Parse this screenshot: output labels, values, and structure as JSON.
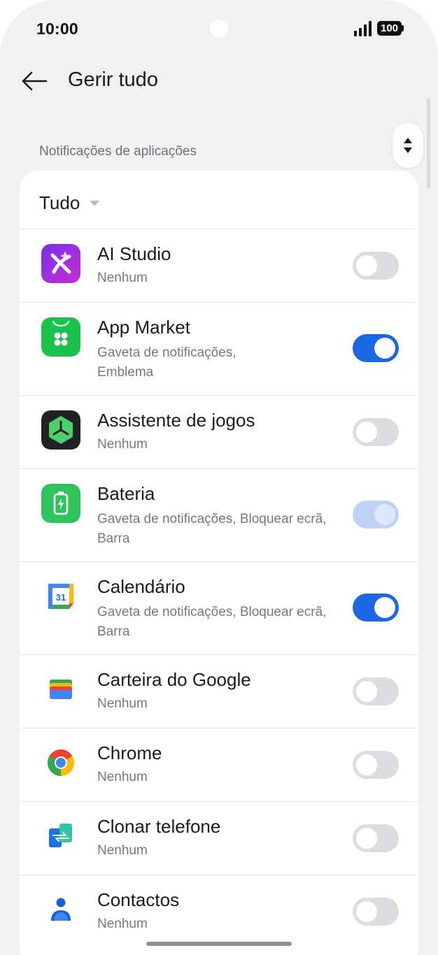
{
  "status_bar": {
    "time": "10:00",
    "battery": "100"
  },
  "header": {
    "title": "Gerir tudo"
  },
  "section": {
    "label": "Notificações de aplicações"
  },
  "filter": {
    "label": "Tudo"
  },
  "apps": [
    {
      "name": "AI Studio",
      "subtitle": "Nenhum",
      "toggle": "off",
      "icon": "ai-studio-icon"
    },
    {
      "name": "App Market",
      "subtitle": "Gaveta de notificações, Emblema",
      "toggle": "on",
      "icon": "app-market-icon"
    },
    {
      "name": "Assistente de jogos",
      "subtitle": "Nenhum",
      "toggle": "off",
      "icon": "games-assistant-icon"
    },
    {
      "name": "Bateria",
      "subtitle": "Gaveta de notificações, Bloquear ecrã, Barra",
      "toggle": "on-disabled",
      "icon": "battery-icon"
    },
    {
      "name": "Calendário",
      "subtitle": "Gaveta de notificações, Bloquear ecrã, Barra",
      "toggle": "on",
      "icon": "calendar-icon"
    },
    {
      "name": "Carteira do Google",
      "subtitle": "Nenhum",
      "toggle": "off",
      "icon": "google-wallet-icon"
    },
    {
      "name": "Chrome",
      "subtitle": "Nenhum",
      "toggle": "off",
      "icon": "chrome-icon"
    },
    {
      "name": "Clonar telefone",
      "subtitle": "Nenhum",
      "toggle": "off",
      "icon": "clone-phone-icon"
    },
    {
      "name": "Contactos",
      "subtitle": "Nenhum",
      "toggle": "off",
      "icon": "contacts-icon"
    }
  ],
  "colors": {
    "accent": "#1b66e6",
    "accent_disabled": "#bdd3f6",
    "background": "#f0f1f3"
  }
}
